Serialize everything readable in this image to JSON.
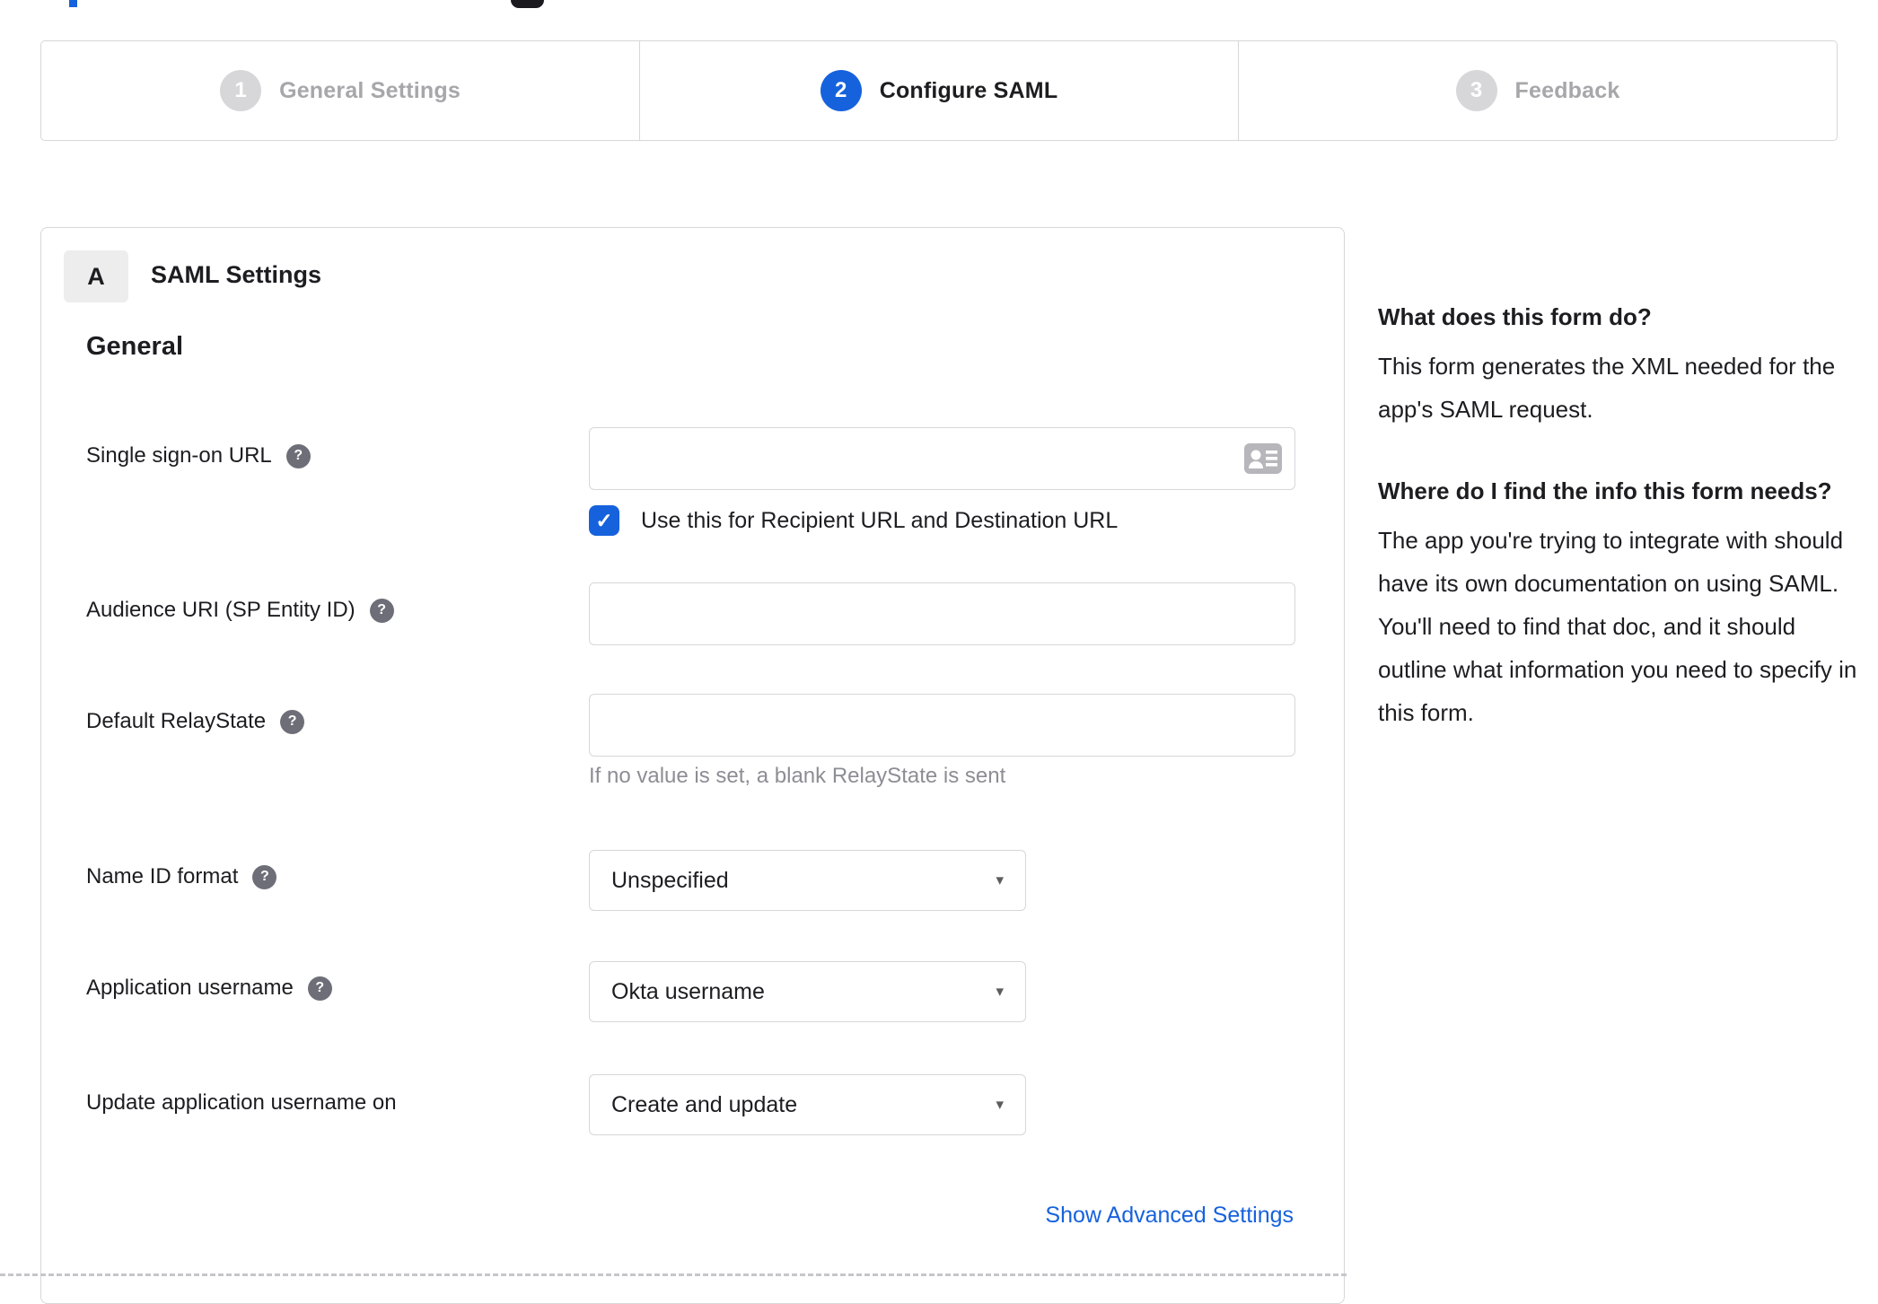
{
  "colors": {
    "accent_blue": "#1662dd",
    "text_dark": "#1d1d21",
    "muted_gray": "#a7a7ab",
    "border_gray": "#d7d7da",
    "hint_gray": "#8d8d95",
    "help_icon_bg": "#6e6e78"
  },
  "icons": {
    "check": "✓",
    "help": "?",
    "caret": "▾"
  },
  "stepper": {
    "steps": [
      {
        "number": "1",
        "label": "General Settings",
        "state": "inactive"
      },
      {
        "number": "2",
        "label": "Configure SAML",
        "state": "active"
      },
      {
        "number": "3",
        "label": "Feedback",
        "state": "inactive"
      }
    ]
  },
  "saml_card": {
    "badge": "A",
    "title": "SAML Settings",
    "section_heading": "General",
    "fields": [
      {
        "label": "Single sign-on URL",
        "has_help": true,
        "type": "text",
        "value": "",
        "checkbox": {
          "checked": true,
          "label": "Use this for Recipient URL and Destination URL"
        }
      },
      {
        "label": "Audience URI (SP Entity ID)",
        "has_help": true,
        "type": "text",
        "value": ""
      },
      {
        "label": "Default RelayState",
        "has_help": true,
        "type": "text",
        "value": "",
        "hint": "If no value is set, a blank RelayState is sent"
      },
      {
        "label": "Name ID format",
        "has_help": true,
        "type": "select",
        "value": "Unspecified"
      },
      {
        "label": "Application username",
        "has_help": true,
        "type": "select",
        "value": "Okta username"
      },
      {
        "label": "Update application username on",
        "has_help": false,
        "type": "select",
        "value": "Create and update"
      }
    ],
    "advanced_link": "Show Advanced Settings"
  },
  "help_panel": {
    "sections": [
      {
        "heading": "What does this form do?",
        "body": "This form generates the XML needed for the app's SAML request."
      },
      {
        "heading": "Where do I find the info this form needs?",
        "body": "The app you're trying to integrate with should have its own documentation on using SAML. You'll need to find that doc, and it should outline what information you need to specify in this form."
      }
    ]
  }
}
